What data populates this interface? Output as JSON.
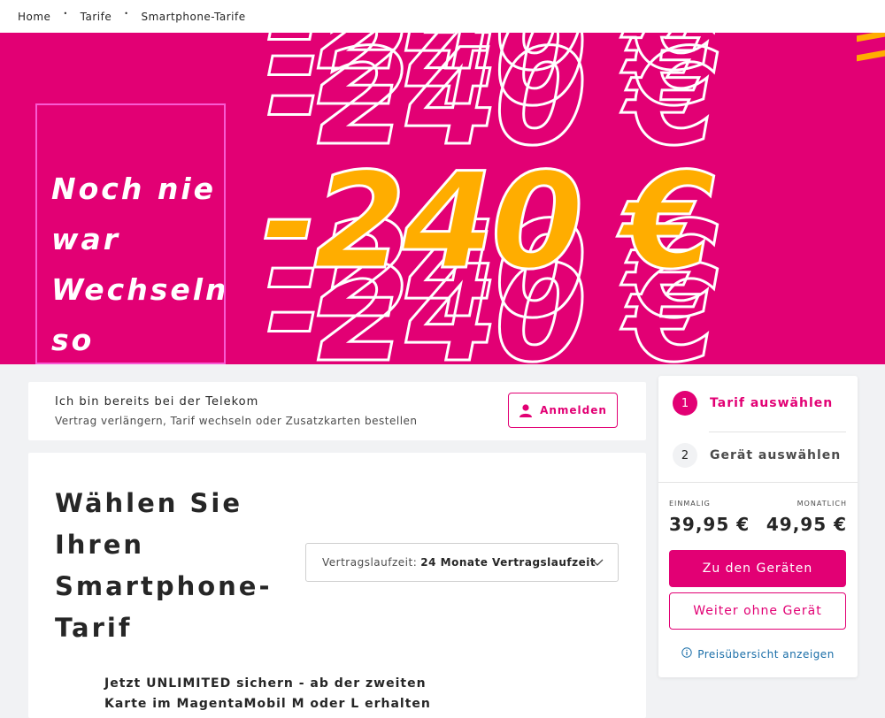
{
  "breadcrumb": {
    "items": [
      "Home",
      "Tarife",
      "Smartphone-Tarife"
    ],
    "separator": "•"
  },
  "hero": {
    "headline_lines": [
      "Noch nie",
      "war",
      "Wechseln",
      "so"
    ],
    "offer": "-240 €",
    "colors": {
      "background": "#e20074",
      "offer": "#ffad00",
      "outline": "#ffffff",
      "box_border": "#f85ad3"
    }
  },
  "login_card": {
    "title": "Ich bin bereits bei der Telekom",
    "subtitle": "Vertrag verlängern, Tarif wechseln oder Zusatzkarten bestellen",
    "button_label": "Anmelden",
    "button_icon": "user-icon"
  },
  "tariff": {
    "heading_lines": [
      "Wählen Sie",
      "Ihren",
      "Smartphone-",
      "Tarif"
    ],
    "term_label": "Vertragslaufzeit:",
    "term_value": "24 Monate Vertragslaufzeit",
    "promo_lines": [
      "Jetzt UNLIMITED sichern - ab der zweiten",
      "Karte im MagentaMobil M oder L erhalten"
    ]
  },
  "sidebar": {
    "steps": [
      {
        "number": "1",
        "label": "Tarif auswählen"
      },
      {
        "number": "2",
        "label": "Gerät auswählen"
      }
    ],
    "once_label": "EINMALIG",
    "once_value": "39,95 €",
    "monthly_label": "MONATLICH",
    "monthly_value": "49,95 €",
    "primary_button": "Zu den Geräten",
    "secondary_button": "Weiter ohne Gerät",
    "price_link": "Preisübersicht anzeigen",
    "price_link_icon": "info-icon"
  },
  "colors": {
    "brand": "#e20074",
    "link": "#1a6ea8",
    "page_bg": "#f1f2f4"
  }
}
